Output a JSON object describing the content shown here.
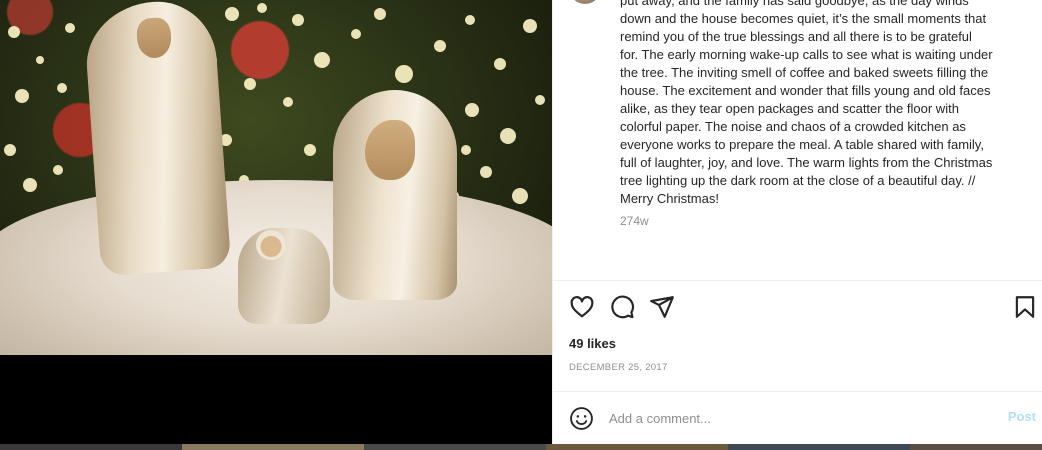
{
  "post": {
    "caption": "put away, and the family has said goodbye, as the day winds\ndown and the house becomes quiet, it’s the small moments that\nremind you of the true blessings and all there is to be grateful\nfor. The early morning wake-up calls to see what is waiting under\nthe tree. The inviting smell of coffee and baked sweets filling the\nhouse. The excitement and wonder that fills young and old faces\nalike, as they tear open packages and scatter the floor with\ncolorful paper. The noise and chaos of a crowded kitchen as\neveryone works to prepare the meal. A table shared with family,\nfull of laughter, joy, and love. The warm lights from the Christmas\ntree lighting up the dark room at the close of a beautiful day. //\nMerry Christmas!",
    "caption_age": "274w",
    "likes": "49 likes",
    "date": "DECEMBER 25, 2017"
  },
  "actions": {
    "like_icon": "heart-icon",
    "comment_icon": "comment-icon",
    "share_icon": "share-icon",
    "save_icon": "bookmark-icon"
  },
  "comment_box": {
    "placeholder": "Add a comment...",
    "post_label": "Post",
    "emoji_icon": "emoji-icon"
  },
  "colors": {
    "text": "#262626",
    "muted": "#8e8e8e",
    "post_disabled": "#b2dffc",
    "divider": "#efefef"
  }
}
